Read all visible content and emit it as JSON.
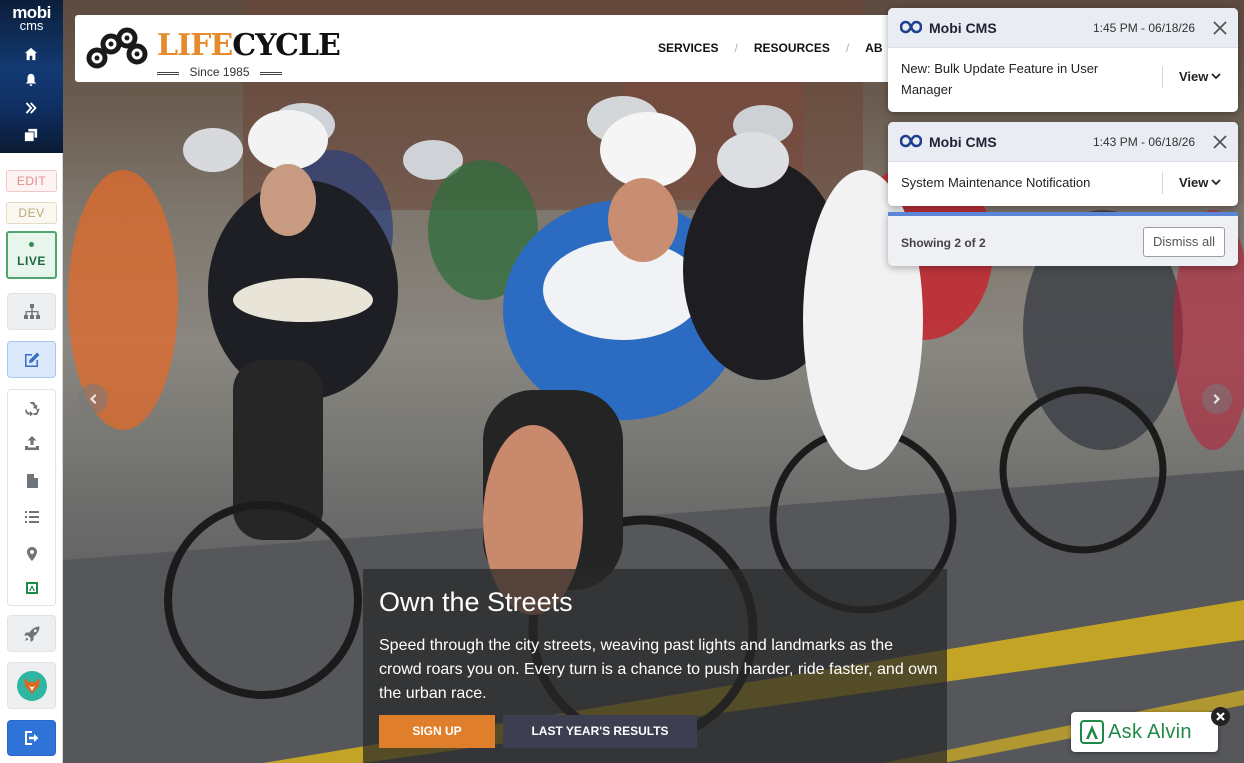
{
  "sidebar": {
    "logo_line1": "mobi",
    "logo_line2": "cms",
    "top_icons": [
      "home-icon",
      "bell-icon",
      "double-chevron-right-icon",
      "copy-icon"
    ],
    "environments": {
      "edit": "EDIT",
      "dev": "DEV",
      "live": "LIVE"
    },
    "tools": [
      "sitemap-icon",
      "edit-page-icon",
      "recycle-icon",
      "upload-icon",
      "file-icon",
      "list-icon",
      "map-pin-icon",
      "alvin-mini-icon"
    ],
    "bottom": [
      "rocket-icon",
      "fox-avatar-icon",
      "logout-icon"
    ]
  },
  "site": {
    "brand_life": "LIFE",
    "brand_cycle": "CYCLE",
    "since": "Since 1985",
    "nav": [
      "SERVICES",
      "RESOURCES",
      "AB"
    ]
  },
  "hero": {
    "title": "Own the Streets",
    "text": "Speed through the city streets, weaving past lights and landmarks as the crowd roars you on. Every turn is a chance to push harder, ride faster, and own the urban race.",
    "primary_button": "SIGN UP",
    "secondary_button": "LAST YEAR'S RESULTS"
  },
  "notifications": [
    {
      "app": "Mobi CMS",
      "time": "1:45 PM - 06/18/26",
      "message": "New: Bulk Update Feature in User Manager",
      "action": "View"
    },
    {
      "app": "Mobi CMS",
      "time": "1:43 PM - 06/18/26",
      "message": "System Maintenance Notification",
      "action": "View"
    }
  ],
  "notifications_footer": {
    "count": "Showing 2 of 2",
    "dismiss": "Dismiss all"
  },
  "assistant": {
    "label": "Ask Alvin"
  },
  "colors": {
    "brand_orange": "#e68a2e",
    "cms_blue": "#2f73d8",
    "live_green": "#4da66d",
    "alvin_green": "#1f8a47"
  }
}
